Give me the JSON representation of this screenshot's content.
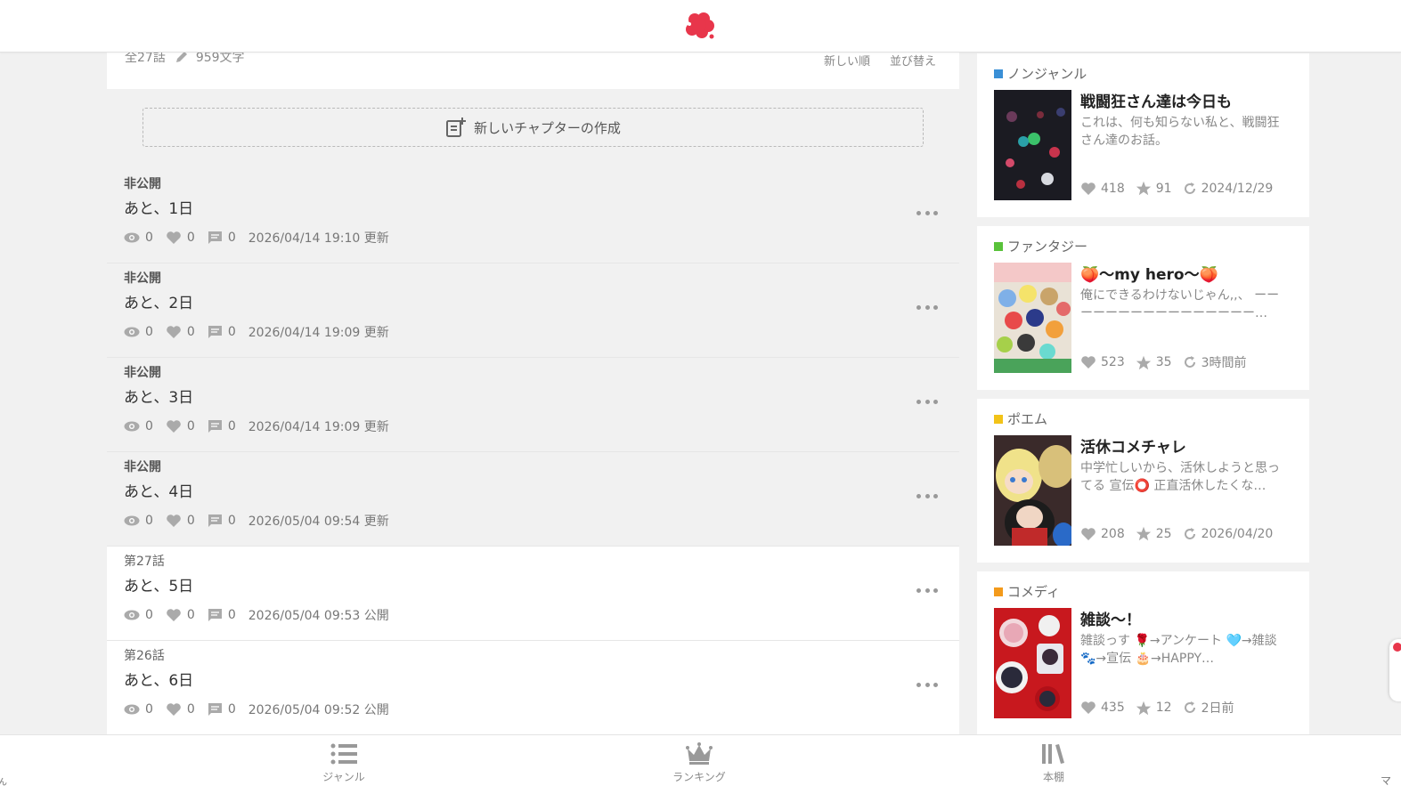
{
  "header": {
    "logo": "flower-logo"
  },
  "work_meta": {
    "episodes": "全27話",
    "chars": "959文字",
    "sort_new": "新しい順",
    "sort_reorder": "並び替え"
  },
  "create_chapter": {
    "label": "新しいチャプターの作成"
  },
  "chapters": [
    {
      "status": "非公開",
      "title": "あと、1日",
      "views": "0",
      "likes": "0",
      "comments": "0",
      "date": "2026/04/14 19:10 更新"
    },
    {
      "status": "非公開",
      "title": "あと、2日",
      "views": "0",
      "likes": "0",
      "comments": "0",
      "date": "2026/04/14 19:09 更新"
    },
    {
      "status": "非公開",
      "title": "あと、3日",
      "views": "0",
      "likes": "0",
      "comments": "0",
      "date": "2026/04/14 19:09 更新"
    },
    {
      "status": "非公開",
      "title": "あと、4日",
      "views": "0",
      "likes": "0",
      "comments": "0",
      "date": "2026/05/04 09:54 更新"
    },
    {
      "status": "第27話",
      "title": "あと、5日",
      "views": "0",
      "likes": "0",
      "comments": "0",
      "date": "2026/05/04 09:53 公開"
    },
    {
      "status": "第26話",
      "title": "あと、6日",
      "views": "0",
      "likes": "0",
      "comments": "0",
      "date": "2026/05/04 09:52 公開"
    }
  ],
  "recommended": [
    {
      "genre": "ノンジャンル",
      "genre_color": "#3a8fd6",
      "title": "戦闘狂さん達は今日も",
      "desc": "これは、何も知らない私と、戦闘狂さん達のお話。",
      "likes": "418",
      "stars": "91",
      "updated": "2024/12/29"
    },
    {
      "genre": "ファンタジー",
      "genre_color": "#59c23a",
      "title": "🍑〜my hero〜🍑",
      "desc": "俺にできるわけないじゃん,,、 ーーーーーーーーーーーーーーーー…",
      "likes": "523",
      "stars": "35",
      "updated": "3時間前"
    },
    {
      "genre": "ポエム",
      "genre_color": "#f2c318",
      "title": "活休コメチャレ",
      "desc": "中学忙しいから、活休しようと思ってる 宣伝⭕ 正直活休したくな…",
      "likes": "208",
      "stars": "25",
      "updated": "2026/04/20"
    },
    {
      "genre": "コメディ",
      "genre_color": "#f39a1b",
      "title": "雑談〜！",
      "desc": "雑談っす 🌹→アンケート 🩵→雑談 🐾→宣伝 🎂→HAPPY…",
      "likes": "435",
      "stars": "12",
      "updated": "2日前"
    }
  ],
  "bottom_nav": {
    "genre": "ジャンル",
    "ranking": "ランキング",
    "bookshelf": "本棚",
    "edge_left": "ん",
    "edge_right": "マ"
  }
}
